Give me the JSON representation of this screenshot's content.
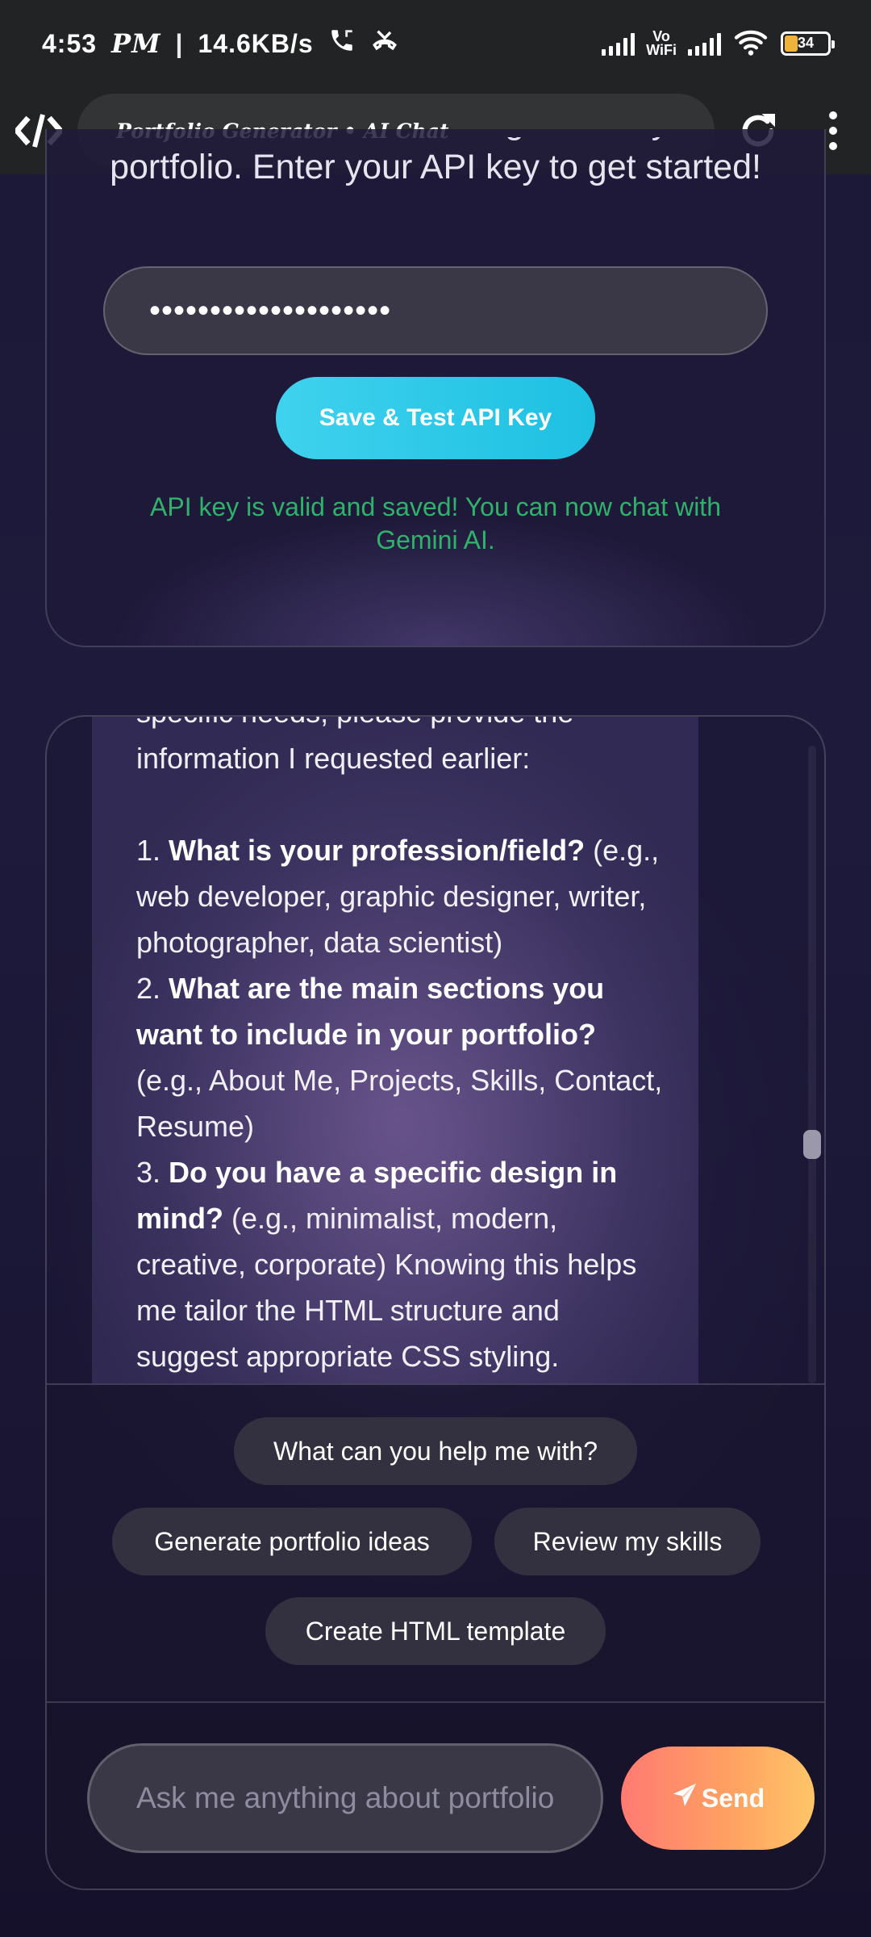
{
  "status_bar": {
    "time": "4:53",
    "ampm": "PM",
    "separator": "|",
    "speed": "14.6KB/s",
    "vowifi_top": "Vo",
    "vowifi_bottom": "WiFi",
    "battery": "34"
  },
  "browser": {
    "page_title": "Portfolio Generator • AI Chat"
  },
  "api_section": {
    "intro_line1": "Chat with Gemini AI to generate your",
    "intro_line2": "portfolio. Enter your API key to get started!",
    "api_key_value": "••••••••••••••••••••",
    "save_button": "Save & Test API Key",
    "status_message": "API key is valid and saved! You can now chat with Gemini AI."
  },
  "chat": {
    "message": {
      "partial_top": "specific needs, please provide the",
      "line_intro": "information I requested earlier:",
      "q1_num": "1.",
      "q1_bold": "What is your profession/field?",
      "q1_rest": "(e.g., web developer, graphic designer, writer, photographer, data scientist)",
      "q2_num": "2.",
      "q2_bold": "What are the main sections you want to include in your portfolio?",
      "q2_rest": "(e.g., About Me, Projects, Skills, Contact, Resume)",
      "q3_num": "3.",
      "q3_bold": "Do you have a specific design in mind?",
      "q3_rest": "(e.g., minimalist, modern, creative, corporate) Knowing this helps me tailor the HTML structure and suggest appropriate CSS styling."
    },
    "suggestions": [
      "What can you help me with?",
      "Generate portfolio ideas",
      "Review my skills",
      "Create HTML template"
    ],
    "input_placeholder": "Ask me anything about portfolio",
    "send_button": "Send"
  }
}
